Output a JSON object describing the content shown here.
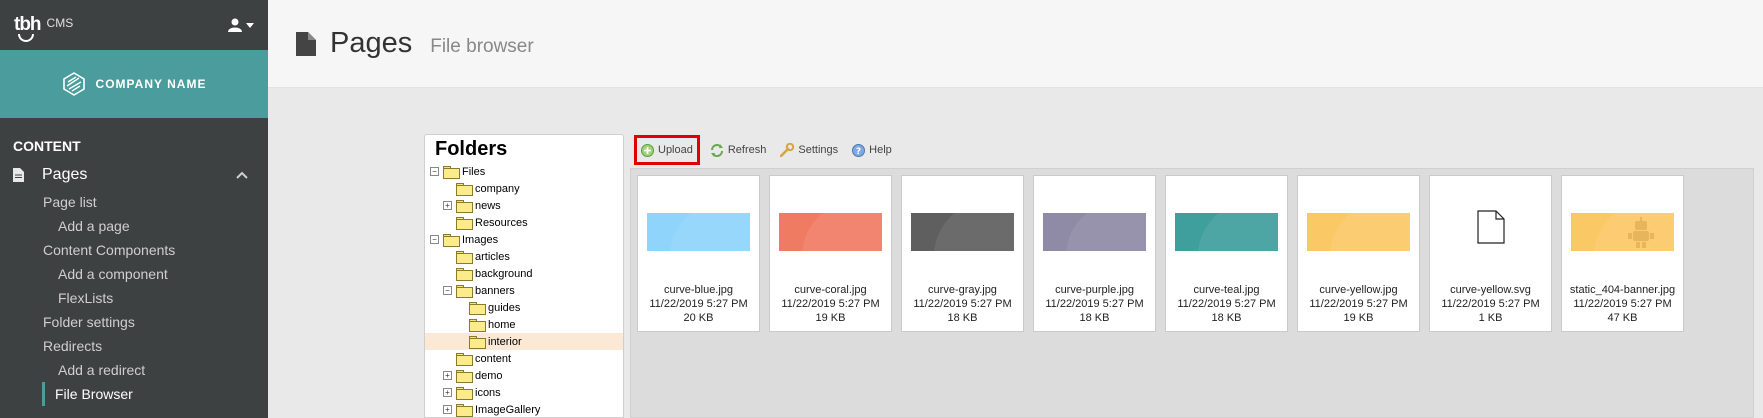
{
  "app": {
    "logo": "tbh",
    "logo_sub": "CMS"
  },
  "brand": {
    "name": "COMPANY NAME"
  },
  "sidebar": {
    "section": "CONTENT",
    "pages_label": "Pages",
    "items": [
      {
        "label": "Page list"
      },
      {
        "label": "Add a page"
      },
      {
        "label": "Content Components"
      },
      {
        "label": "Add a component"
      },
      {
        "label": "FlexLists"
      },
      {
        "label": "Folder settings"
      },
      {
        "label": "Redirects"
      },
      {
        "label": "Add a redirect"
      },
      {
        "label": "File Browser"
      }
    ]
  },
  "header": {
    "title": "Pages",
    "subtitle": "File browser"
  },
  "folders": {
    "title": "Folders",
    "tree": [
      {
        "label": "Files"
      },
      {
        "label": "company"
      },
      {
        "label": "news"
      },
      {
        "label": "Resources"
      },
      {
        "label": "Images"
      },
      {
        "label": "articles"
      },
      {
        "label": "background"
      },
      {
        "label": "banners"
      },
      {
        "label": "guides"
      },
      {
        "label": "home"
      },
      {
        "label": "interior"
      },
      {
        "label": "content"
      },
      {
        "label": "demo"
      },
      {
        "label": "icons"
      },
      {
        "label": "ImageGallery"
      }
    ]
  },
  "toolbar": {
    "upload": "Upload",
    "refresh": "Refresh",
    "settings": "Settings",
    "help": "Help"
  },
  "files": [
    {
      "name": "curve-blue.jpg",
      "date": "11/22/2019 5:27 PM",
      "size": "20 KB",
      "color": "#8fd4fb"
    },
    {
      "name": "curve-coral.jpg",
      "date": "11/22/2019 5:27 PM",
      "size": "19 KB",
      "color": "#f07b63"
    },
    {
      "name": "curve-gray.jpg",
      "date": "11/22/2019 5:27 PM",
      "size": "18 KB",
      "color": "#5f5f5f"
    },
    {
      "name": "curve-purple.jpg",
      "date": "11/22/2019 5:27 PM",
      "size": "18 KB",
      "color": "#8f8aa6"
    },
    {
      "name": "curve-teal.jpg",
      "date": "11/22/2019 5:27 PM",
      "size": "18 KB",
      "color": "#3f9f9d"
    },
    {
      "name": "curve-yellow.jpg",
      "date": "11/22/2019 5:27 PM",
      "size": "19 KB",
      "color": "#fbc866"
    },
    {
      "name": "curve-yellow.svg",
      "date": "11/22/2019 5:27 PM",
      "size": "1 KB",
      "color": ""
    },
    {
      "name": "static_404-banner.jpg",
      "date": "11/22/2019 5:27 PM",
      "size": "47 KB",
      "color": "#fbc866"
    }
  ]
}
